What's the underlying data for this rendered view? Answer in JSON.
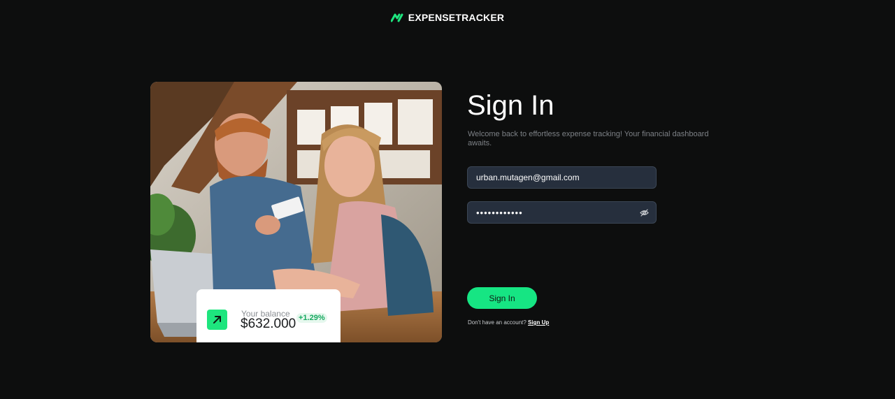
{
  "brand": {
    "name": "EXPENSETRACKER",
    "accent_color": "#1ee57e"
  },
  "photo_card": {
    "image_description_icon": "couple-laptop-photo",
    "balance": {
      "label": "Your balance",
      "value": "$632.000",
      "change": "+1.29%",
      "icon": "arrow-up-right-icon"
    }
  },
  "form": {
    "title": "Sign In",
    "subtitle": "Welcome back to effortless expense tracking! Your financial dashboard awaits.",
    "email": {
      "value": "urban.mutagen@gmail.com"
    },
    "password": {
      "value": "••••••••••••",
      "toggle_icon": "eye-off-icon"
    },
    "submit_label": "Sign In",
    "signup_prompt": "Don't have an account?",
    "signup_link": "Sign Up"
  }
}
